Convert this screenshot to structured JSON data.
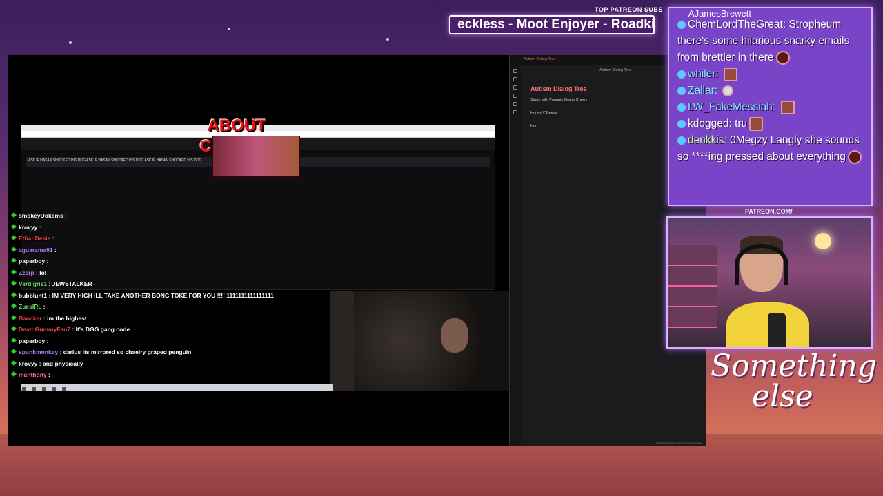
{
  "banner": {
    "top_label": "TOP PATREON SUBS",
    "ticker": "eckless - Moot Enjoyer - Roadkill"
  },
  "stream_overlay": {
    "about_title": "ABOUT CHAIERY",
    "browser_pinned": "ASK IF HASAN SHOCKED HIS DOG  ASK IF HASAN SHOCKED HIS DOG  ASK IF HASAN SHOCKED HIS DOG"
  },
  "overlay_chat": [
    {
      "user": "smokeyDokems",
      "msg": "",
      "color": "white"
    },
    {
      "user": "krovyy",
      "msg": "",
      "color": "white"
    },
    {
      "user": "EthanDesis",
      "msg": "",
      "color": "red"
    },
    {
      "user": "aguarama91",
      "msg": "",
      "color": "purple"
    },
    {
      "user": "paperboy",
      "msg": "",
      "color": "white"
    },
    {
      "user": "Zzerp",
      "msg": "lol",
      "color": "purple"
    },
    {
      "user": "Verdigris1",
      "msg": "JEWSTALKER",
      "color": "green"
    },
    {
      "user": "bubblunt1",
      "msg": "IM VERY HIGH ILL TAKE ANOTHER BONG TOKE FOR YOU !!!! 1111111111111111",
      "color": "white"
    },
    {
      "user": "ZuesIRL",
      "msg": "",
      "color": "green"
    },
    {
      "user": "Baocker",
      "msg": "im the highest",
      "color": "red"
    },
    {
      "user": "DeathGummyFan7",
      "msg": "It's DGG gang code",
      "color": "red"
    },
    {
      "user": "paperboy",
      "msg": "",
      "color": "white"
    },
    {
      "user": "spunkmonkey",
      "msg": "darius its mirrored so chaeiry graped penguin",
      "color": "purple"
    },
    {
      "user": "krovyy",
      "msg": "and physically",
      "color": "white"
    },
    {
      "user": "manthony",
      "msg": "",
      "color": "pink"
    }
  ],
  "notes_app": {
    "tab": "Autism Dialog Tree",
    "header": "Autism Dialog Tree",
    "title": "Autism Dialog Tree",
    "lines": [
      "Starts with Penguin Grape Cherry",
      "Honey V Deeds",
      "Hon"
    ],
    "status": "0 backlinks   5 words   51 characters"
  },
  "side_chat": {
    "partial_top": "— AJamesBrewett —",
    "messages": [
      {
        "user": "ChemLordTheGreat",
        "msg": "Stropheum there's some hilarious snarky emails from brettler in there",
        "color": "white",
        "emote": "round"
      },
      {
        "user": "whiler",
        "msg": "",
        "color": "teal",
        "emote": "square"
      },
      {
        "user": "Zallar",
        "msg": "",
        "color": "teal",
        "emote": "small"
      },
      {
        "user": "LW_FakeMessiah",
        "msg": "",
        "color": "teal",
        "emote": "square"
      },
      {
        "user": "kdogged",
        "msg": "tru",
        "color": "white",
        "emote": "square"
      },
      {
        "user": "denkkis",
        "msg": "0Megzy Langly she sounds so ****ing pressed about everything",
        "color": "lime",
        "emote": "round"
      }
    ]
  },
  "webcam": {
    "label": "PATREON.COM/"
  },
  "brand": {
    "line1": "Something",
    "line2": "else"
  }
}
